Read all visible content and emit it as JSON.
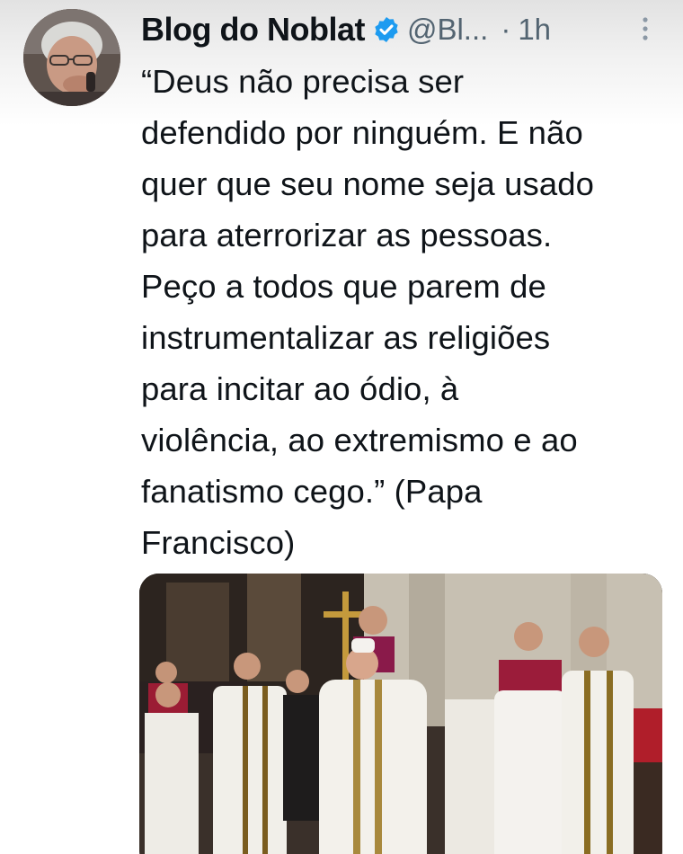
{
  "tweet": {
    "display_name": "Blog do Noblat",
    "handle": "@Bl...",
    "separator": "·",
    "timestamp": "1h",
    "text": "“Deus não precisa ser\ndefendido por ninguém. E não\nquer que seu nome seja usado\npara aterrorizar as pessoas.\nPeço a todos que parem de\ninstrumentalizar as religiões\npara incitar ao ódio, à\nviolência, ao extremismo e ao\nfanatismo cego.” (Papa\nFrancisco)"
  },
  "icons": {
    "verified": "verified-badge-icon",
    "more": "more-options-icon"
  },
  "colors": {
    "verified_blue": "#1d9bf0",
    "text_primary": "#0f1419",
    "text_secondary": "#536471"
  }
}
